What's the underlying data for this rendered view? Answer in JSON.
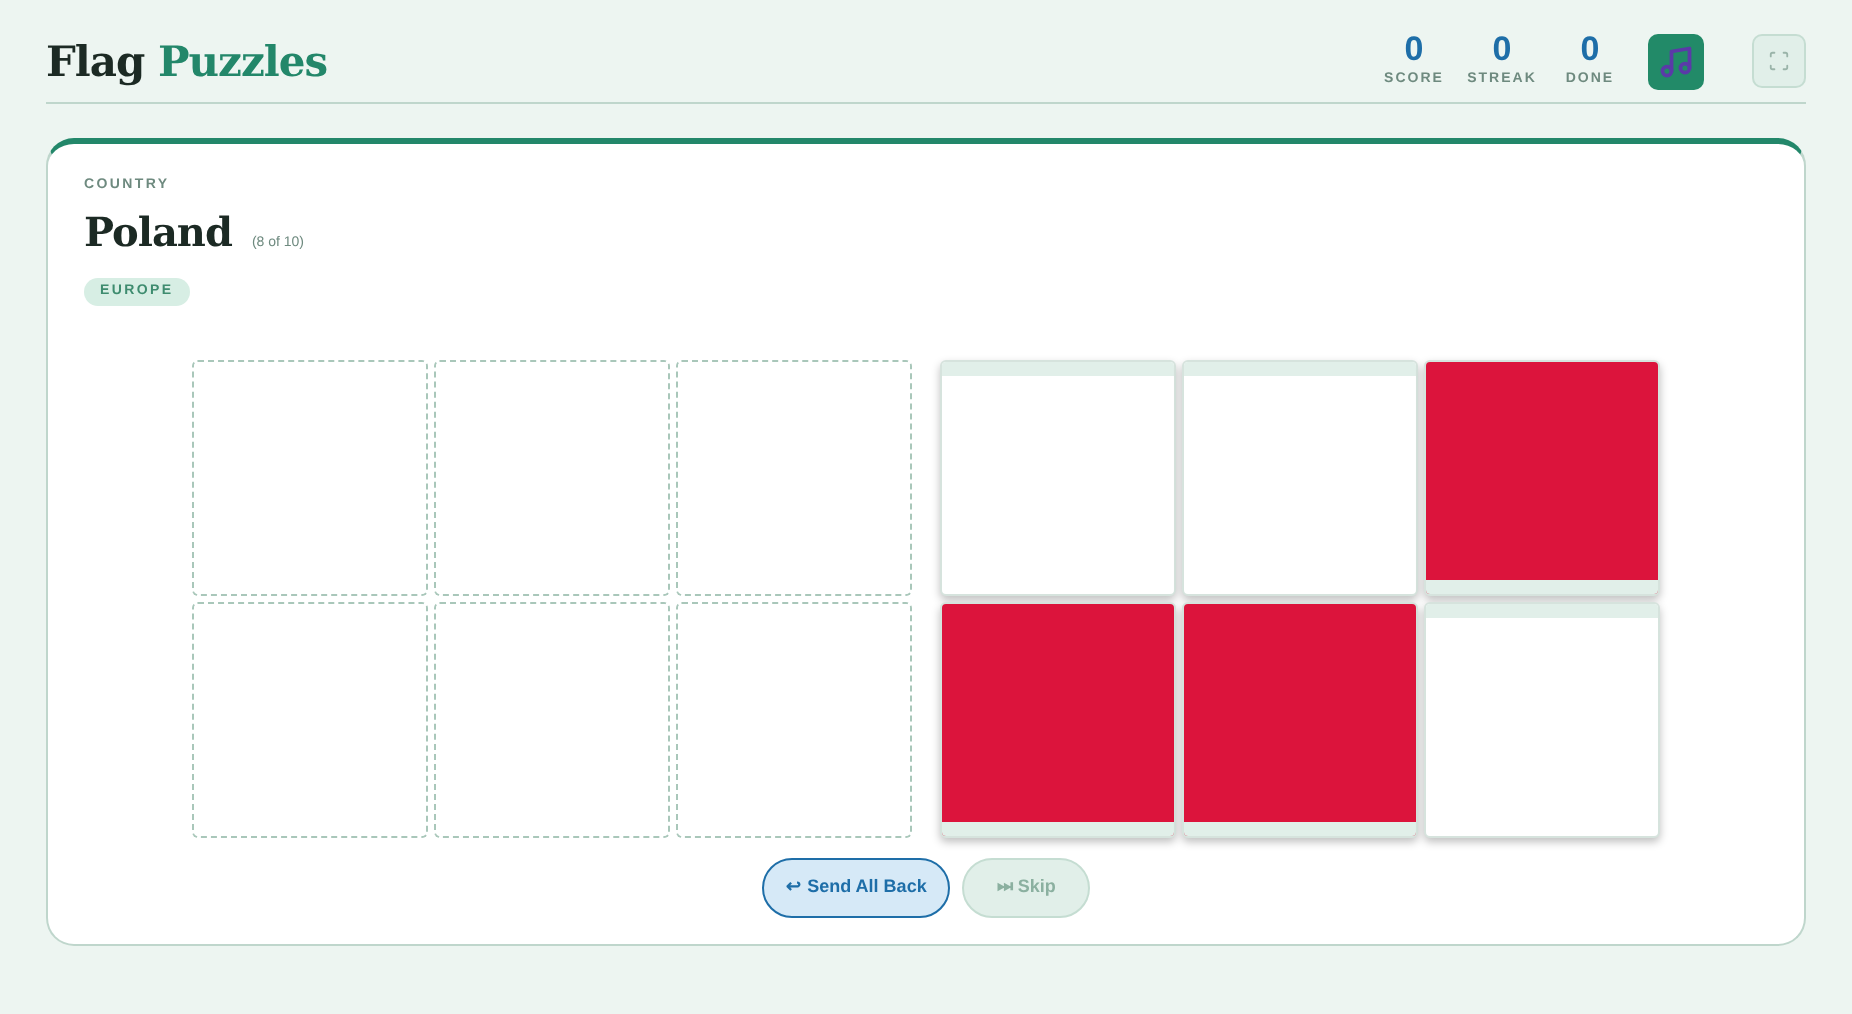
{
  "header": {
    "title_part_1": "Flag",
    "title_part_2": "Puzzles"
  },
  "stats": [
    {
      "value": "0",
      "label": "SCORE"
    },
    {
      "value": "0",
      "label": "STREAK"
    },
    {
      "value": "0",
      "label": "DONE"
    }
  ],
  "card": {
    "eyebrow": "COUNTRY",
    "country": "Poland",
    "progress": "(8 of 10)",
    "region": "EUROPE"
  },
  "slots": [
    {
      "filled": false
    },
    {
      "filled": false
    },
    {
      "filled": false
    },
    {
      "filled": false
    },
    {
      "filled": false
    },
    {
      "filled": false
    }
  ],
  "pieces": [
    {
      "kind": "upper",
      "color": "#ffffff"
    },
    {
      "kind": "upper",
      "color": "#ffffff"
    },
    {
      "kind": "lower",
      "color": "#dc143c"
    },
    {
      "kind": "lower",
      "color": "#dc143c"
    },
    {
      "kind": "lower",
      "color": "#dc143c"
    },
    {
      "kind": "upper",
      "color": "#ffffff"
    }
  ],
  "buttons": [
    {
      "icon": "↩",
      "label": "Send All Back",
      "disabled": false
    },
    {
      "icon": "⏭",
      "label": "Skip",
      "disabled": true
    }
  ]
}
